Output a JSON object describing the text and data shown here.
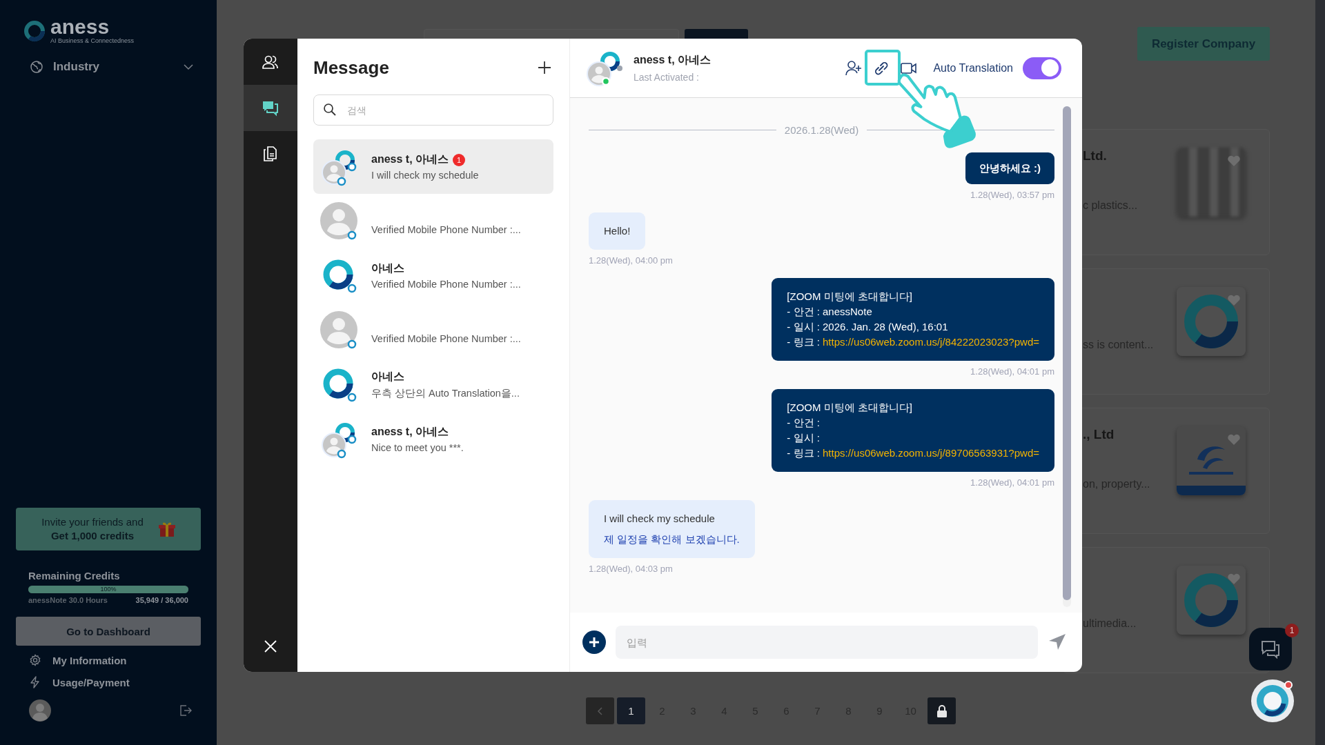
{
  "sidebar": {
    "logo": {
      "name": "aness",
      "tagline": "AI Business & Connectedness"
    },
    "menu": [
      {
        "label": "Industry",
        "expanded": false
      }
    ],
    "invite": {
      "line1": "Invite your friends and",
      "line2": "Get 1,000 credits"
    },
    "credits": {
      "title": "Remaining Credits",
      "level": 1,
      "percent": "100%",
      "plan": "anessNote 30.0 Hours",
      "amount": "35,949 / 36,000"
    },
    "dashboard_button": "Go to Dashboard",
    "links": [
      {
        "label": "My Information"
      },
      {
        "label": "Usage/Payment"
      }
    ]
  },
  "page": {
    "register_button": "Register Company",
    "cards": [
      {
        "title": "Ltd.",
        "snippet": "c plastics...",
        "kind": "blurred"
      },
      {
        "snippet": "ss is content...",
        "kind": "logo"
      },
      {
        "title": "., Ltd",
        "snippet": "on, property...",
        "kind": "emblem"
      },
      {
        "snippet": "ultimedia...",
        "kind": "logo"
      }
    ],
    "pagination": {
      "pages": [
        {
          "label": "1",
          "selected": true
        },
        {
          "label": "2",
          "selected": false
        },
        {
          "label": "3",
          "selected": false
        },
        {
          "label": "4",
          "selected": false
        },
        {
          "label": "5",
          "selected": false
        },
        {
          "label": "6",
          "selected": false
        },
        {
          "label": "7",
          "selected": false
        },
        {
          "label": "8",
          "selected": false
        },
        {
          "label": "9",
          "selected": false
        },
        {
          "label": "10",
          "selected": false
        }
      ]
    }
  },
  "floating": {
    "chat_badge": "1",
    "alert": true
  },
  "modal": {
    "rail": [
      {
        "selected": false
      },
      {
        "selected": true
      },
      {
        "selected": false
      }
    ],
    "list": {
      "title": "Message",
      "search_placeholder": "검색",
      "conversations": [
        {
          "kind": "pair",
          "name": "aness t, 아네스",
          "unread": "1",
          "preview": "I will check my schedule",
          "online": true,
          "selected": true
        },
        {
          "kind": "person",
          "preview": "Verified Mobile Phone Number :...",
          "online": true,
          "selected": false
        },
        {
          "kind": "logo",
          "name": "아네스",
          "preview": "Verified Mobile Phone Number :...",
          "online": true,
          "selected": false
        },
        {
          "kind": "person",
          "preview": "Verified Mobile Phone Number :...",
          "online": true,
          "selected": false
        },
        {
          "kind": "logo",
          "name": "아네스",
          "preview": "우측 상단의 Auto Translation을...",
          "online": true,
          "selected": false
        },
        {
          "kind": "pair",
          "name": "aness t, 아네스",
          "preview": "Nice to meet you ***.",
          "online": true,
          "selected": false
        }
      ]
    },
    "chat": {
      "name": "aness t, 아네스",
      "status": "Last Activated :",
      "online": true,
      "auto_translation": {
        "label": "Auto Translation",
        "on": true
      },
      "date": "2026.1.28(Wed)",
      "messages": [
        {
          "kind": "sent",
          "bold": true,
          "lines": [
            {
              "text": "안녕하세요 :)"
            }
          ],
          "time": "1.28(Wed), 03:57 pm"
        },
        {
          "kind": "received",
          "lines": [
            {
              "text": "Hello!"
            }
          ],
          "time": "1.28(Wed), 04:00 pm"
        },
        {
          "kind": "sent",
          "lines": [
            {
              "text": "[ZOOM 미팅에 초대합니다]"
            },
            {
              "text": "- 안건 : anessNote"
            },
            {
              "text": "- 일시 : 2026. Jan. 28 (Wed), 16:01"
            },
            {
              "text": "- 링크 : ",
              "link": "https://us06web.zoom.us/j/84222023023?pwd="
            }
          ],
          "time": "1.28(Wed), 04:01 pm"
        },
        {
          "kind": "sent",
          "lines": [
            {
              "text": "[ZOOM 미팅에 초대합니다]"
            },
            {
              "text": "- 안건 :"
            },
            {
              "text": "- 일시 :"
            },
            {
              "text": "- 링크 : ",
              "link": "https://us06web.zoom.us/j/89706563931?pwd="
            }
          ],
          "time": "1.28(Wed), 04:01 pm"
        },
        {
          "kind": "received",
          "lines": [
            {
              "text": "I will check my schedule"
            }
          ],
          "translation": "제 일정을 확인해 보겠습니다.",
          "time": "1.28(Wed), 04:03 pm"
        }
      ],
      "input_placeholder": "입력"
    }
  }
}
